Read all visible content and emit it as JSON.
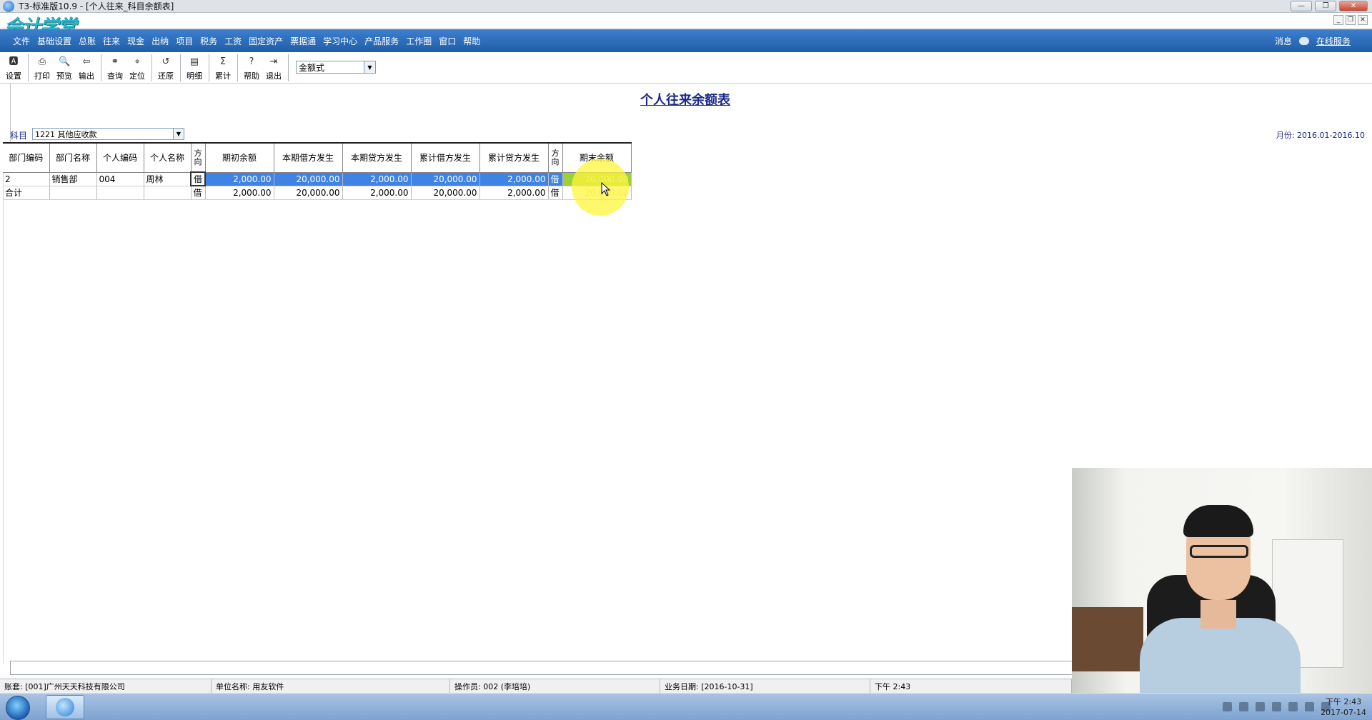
{
  "window": {
    "title": "T3-标准版10.9 - [个人往来_科目余额表]",
    "logo_text": "会计学堂"
  },
  "menu": {
    "items": [
      "文件",
      "基础设置",
      "总账",
      "往来",
      "现金",
      "出纳",
      "项目",
      "税务",
      "工资",
      "固定资产",
      "票据通",
      "学习中心",
      "产品服务",
      "工作圈",
      "窗口",
      "帮助"
    ],
    "messages": "消息",
    "online_service": "在线服务"
  },
  "toolbar": {
    "settings": "设置",
    "print": "打印",
    "preview": "预览",
    "export": "输出",
    "query": "查询",
    "locate": "定位",
    "restore": "还原",
    "detail": "明细",
    "cumulative": "累计",
    "help": "帮助",
    "exit": "退出",
    "format_select": "金额式"
  },
  "report": {
    "title": "个人往来余额表",
    "subject_label": "科目",
    "subject_value": "1221 其他应收款",
    "period": "月份: 2016.01-2016.10",
    "headers": [
      "部门编码",
      "部门名称",
      "个人编码",
      "个人名称",
      "方向",
      "期初余额",
      "本期借方发生",
      "本期贷方发生",
      "累计借方发生",
      "累计贷方发生",
      "方向",
      "期末余额"
    ],
    "rows": [
      [
        "2",
        "销售部",
        "004",
        "周林",
        "借",
        "2,000.00",
        "20,000.00",
        "2,000.00",
        "20,000.00",
        "2,000.00",
        "借",
        "20,000.00"
      ],
      [
        "合计",
        "",
        "",
        "",
        "借",
        "2,000.00",
        "20,000.00",
        "2,000.00",
        "20,000.00",
        "2,000.00",
        "借",
        "20,000.00"
      ]
    ]
  },
  "statusbar": {
    "account": "账套: [001]广州天天科技有限公司",
    "unit": "单位名称: 用友软件",
    "operator": "操作员: 002 (李培培)",
    "business_date": "业务日期: [2016-10-31]",
    "time": "下午 2:43"
  },
  "taskbar": {
    "clock_time": "下午 2:43",
    "clock_date": "2017-07-14"
  }
}
